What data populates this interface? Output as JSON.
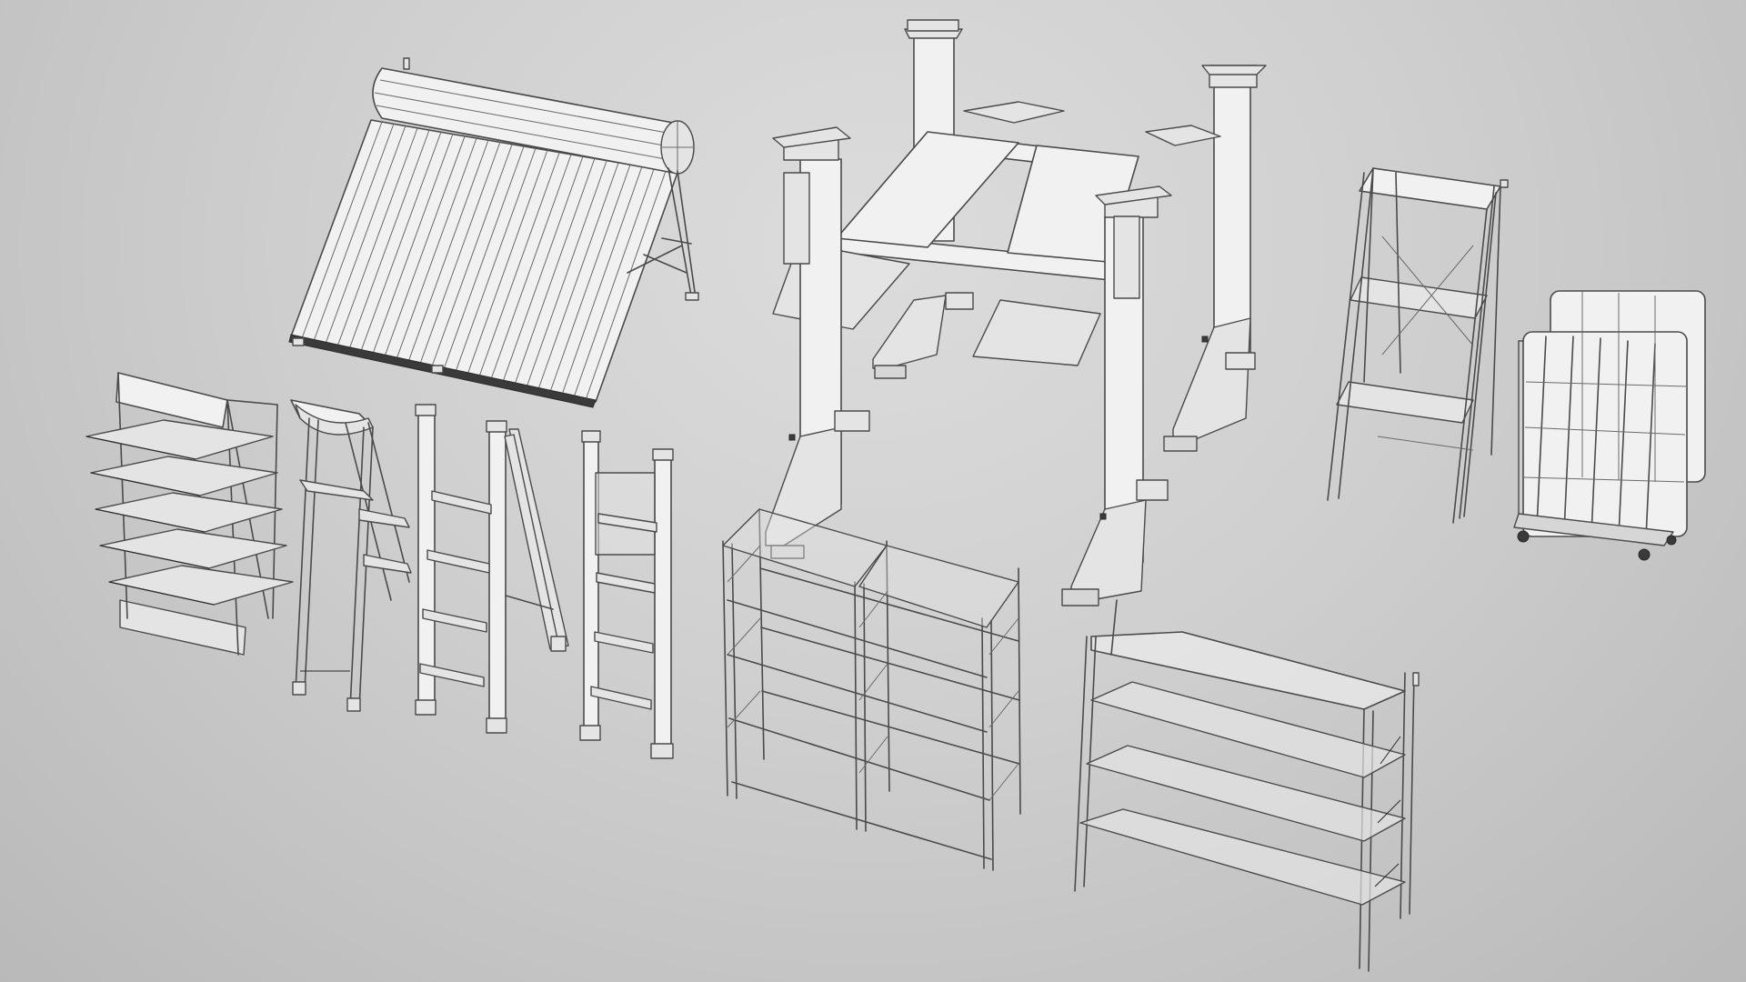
{
  "scene": {
    "background_color": "#c9c9c9",
    "wire_color": "#4a4a4a",
    "surface_color": "#f1f1f1",
    "objects": [
      {
        "name": "solar-water-heater",
        "icon": "solar-water-heater-model"
      },
      {
        "name": "four-post-car-lift",
        "icon": "car-lift-model"
      },
      {
        "name": "metal-rack-tall",
        "icon": "tall-rack-model"
      },
      {
        "name": "roll-cage-trolley",
        "icon": "roll-cage-model"
      },
      {
        "name": "display-shelf-unit",
        "icon": "display-shelf-model"
      },
      {
        "name": "step-stool-ladder",
        "icon": "step-stool-model"
      },
      {
        "name": "a-frame-ladder",
        "icon": "a-frame-ladder-model"
      },
      {
        "name": "straight-step-ladder",
        "icon": "step-ladder-model"
      },
      {
        "name": "double-bay-rack",
        "icon": "double-rack-model"
      },
      {
        "name": "four-tier-shelving",
        "icon": "shelving-model"
      }
    ]
  }
}
